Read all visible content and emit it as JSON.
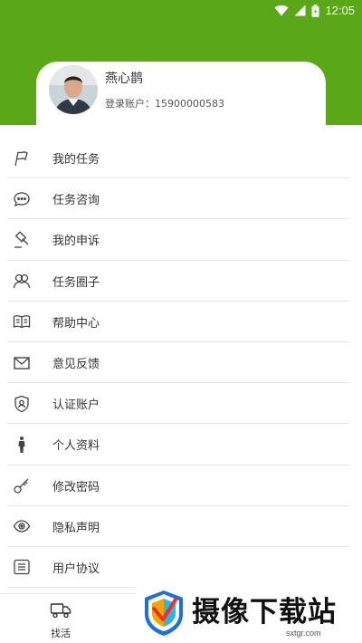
{
  "status_bar": {
    "time": "12:05"
  },
  "profile": {
    "name": "燕心鹊",
    "account": "登录账户：15900000583"
  },
  "menu": [
    {
      "label": "我的任务",
      "icon": "flag-icon"
    },
    {
      "label": "任务咨询",
      "icon": "chat-bubble-icon"
    },
    {
      "label": "我的申诉",
      "icon": "gavel-icon"
    },
    {
      "label": "任务圈子",
      "icon": "people-icon"
    },
    {
      "label": "帮助中心",
      "icon": "book-icon"
    },
    {
      "label": "意见反馈",
      "icon": "envelope-icon"
    },
    {
      "label": "认证账户",
      "icon": "shield-user-icon"
    },
    {
      "label": "个人资料",
      "icon": "person-icon"
    },
    {
      "label": "修改密码",
      "icon": "key-icon"
    },
    {
      "label": "隐私声明",
      "icon": "eye-icon"
    },
    {
      "label": "用户协议",
      "icon": "list-icon"
    }
  ],
  "bottom_nav": {
    "item_label": "找活"
  },
  "watermark": {
    "text": "摄像下载站",
    "url": "sxtgr.com"
  },
  "colors": {
    "header_green": "#5aa818",
    "text": "#333333",
    "divider": "#e4e4e4"
  }
}
